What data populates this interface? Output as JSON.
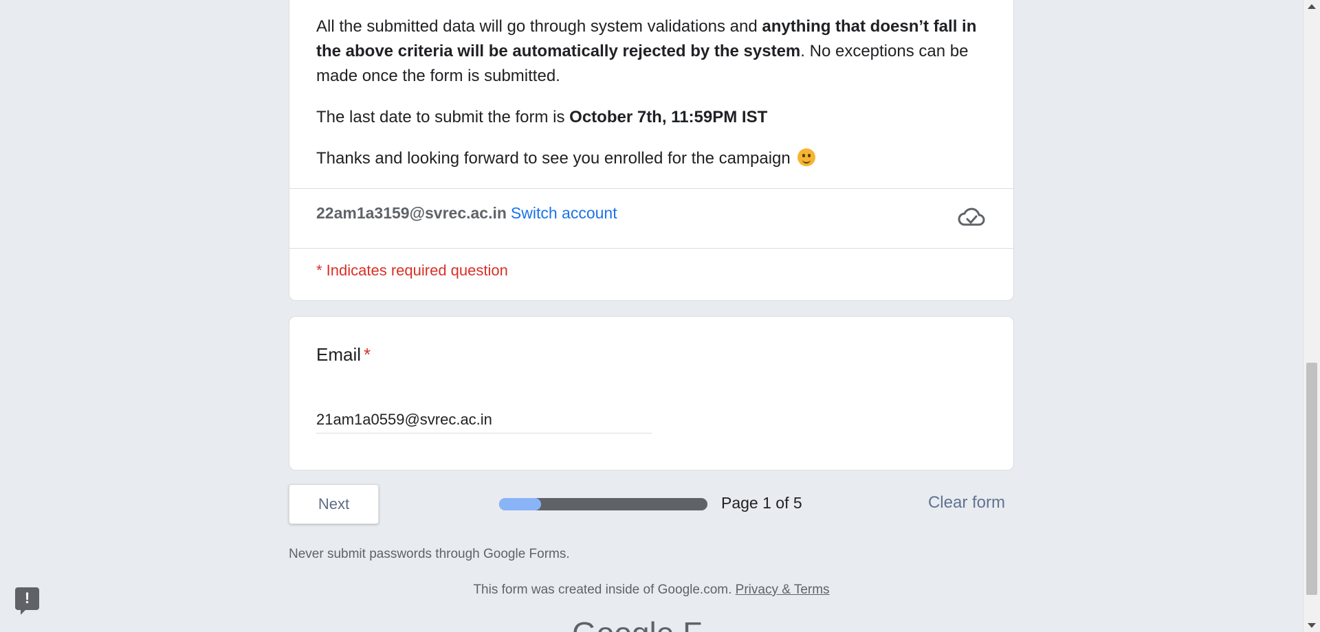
{
  "description": {
    "para1_prefix": "All the submitted data will go through system validations and ",
    "para1_bold": "anything that doesn’t fall in the above criteria will be automatically rejected by the system",
    "para1_suffix": ". No exceptions can be made once the form is submitted.",
    "para2_prefix": "The last date to submit the form is ",
    "para2_bold": "October 7th, 11:59PM IST",
    "para3": "Thanks and looking forward to see you enrolled for the campaign"
  },
  "account": {
    "email": "22am1a3159@svrec.ac.in",
    "switch_label": "Switch account",
    "saved_icon": "cloud-check-icon"
  },
  "required_note": "* Indicates required question",
  "question": {
    "title": "Email",
    "required_mark": "*",
    "value": "21am1a0559@svrec.ac.in"
  },
  "navigation": {
    "next_label": "Next",
    "page_label": "Page 1 of 5",
    "progress_fraction": 0.2,
    "clear_label": "Clear form"
  },
  "never_note": "Never submit passwords through Google Forms.",
  "footer": {
    "created_text": "This form was created inside of Google.com.",
    "privacy_link": "Privacy & Terms",
    "brand_partial": "Google F"
  },
  "colors": {
    "accent": "#1a73e8",
    "required": "#d93025",
    "progress_fill": "#8ab4f8",
    "background": "#e8ebef"
  }
}
